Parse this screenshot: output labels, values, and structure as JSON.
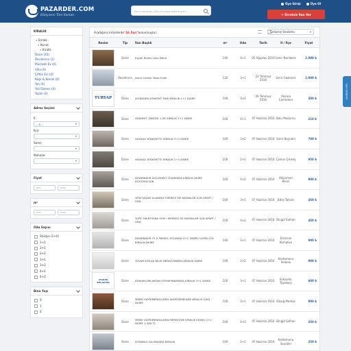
{
  "header": {
    "logo_title": "PAZARDER.COM",
    "logo_sub": "Dünyanın Tüm İlanları",
    "search_placeholder": "İlan numarası, ofis adı veya kelime girin...",
    "user_login": "Üye Girişi",
    "user_register": "Üye Ol",
    "post_button": "+ Ücretsiz İlan Ver"
  },
  "feedback_tab": "Geri Bildirim",
  "sidebar": {
    "category_title": "KİRALIK",
    "tree": [
      "» Emlak",
      "» Konut",
      "» Kiralık"
    ],
    "categories": [
      "Daire (45)",
      "Residence (1)",
      "Müstakil Ev (0)",
      "Villa (0)",
      "Çiftlik Evi (0)",
      "Köşk & Konak (0)",
      "Yalı (0)",
      "Yalı Dairesi (0)",
      "Yazlık (0)"
    ],
    "address_title": "Adres Seçimi",
    "il_label": "İl:",
    "il_value": "-- İl --",
    "ilce_label": "İlçe:",
    "semt_label": "Semt:",
    "mahalle_label": "Mahalle:",
    "price_title": "Fiyat",
    "price_min": "min",
    "price_max": "max",
    "area_title": "m²",
    "area_min": "min",
    "area_max": "max",
    "rooms_title": "Oda Sayısı",
    "rooms": [
      "Stüdyo (1+0)",
      "1+1",
      "2+1",
      "2+2",
      "3+1",
      "3+2",
      "4+1",
      "4+2"
    ],
    "age_title": "Bina Yaşı",
    "ages": [
      "0",
      "1",
      "2"
    ]
  },
  "results": {
    "prefix": "Aradığınız kriterlerde ",
    "count": "\"46 İlan\"",
    "suffix": " bulunmuştur.",
    "sort_label": "Gelişmiş Sıralama",
    "columns": [
      "Resim",
      "Tip",
      "İlan Başlık",
      "m²",
      "Oda",
      "Tarih",
      "İl / İlçe",
      "Fiyat"
    ],
    "rows": [
      {
        "thumb": "th1",
        "type": "Daire",
        "title": "Eşyalı Kiralık Lüks Daire",
        "m2": "140",
        "oda": "4+1",
        "date": "05 Ağustos 2016",
        "loc": "İzmir Narlıdere",
        "price": "2.000 ₺"
      },
      {
        "thumb": "th2",
        "type": "Residence",
        "title": "Zorlu Center Tetse Evler",
        "m2": "120",
        "oda": "3+1",
        "date": "23 Temmuz 2016",
        "loc": "İzmir Gaziemir",
        "price": "2.000 ₺"
      },
      {
        "thumb": "th3",
        "thumb_text": "TURYAP",
        "type": "Daire",
        "title": "ACIBADEM ATAKENT YANI KİRALIK 1+1 DAİRE",
        "m2": "100",
        "oda": "3+2",
        "date": "09 Temmuz 2016",
        "loc": "Ankara Çamlıdere",
        "price": "300 ₺"
      },
      {
        "thumb": "th4",
        "type": "Daire",
        "title": "ATAKENT ,DİKEDE 1 DE KİRALIK 3+1 DAİRE",
        "m2": "100",
        "oda": "4+1",
        "date": "07 Haziran 2016",
        "loc": "Bolu Mudurnu",
        "price": "210 ₺"
      },
      {
        "thumb": "th5",
        "type": "Daire",
        "title": "HALKALI ATAKENTTE KİRALIK 3+1 DAİRE",
        "m2": "100",
        "oda": "3+2",
        "date": "07 Haziran 2016",
        "loc": "İzmir Bayraklı",
        "price": "700 ₺"
      },
      {
        "thumb": "th6",
        "type": "Daire",
        "title": "HALKALI ATAKENTTE KİRALIK 2+1 DAİRE",
        "m2": "100",
        "oda": "2+2",
        "date": "07 Haziran 2016",
        "loc": "Çankırı Çerkeş",
        "price": "950 ₺"
      },
      {
        "thumb": "th7",
        "type": "Daire",
        "title": "DİYARBAKIR DİCLEKENT CİVARINDA KİRALIK DAİRE 05332841306",
        "m2": "100",
        "oda": "4+2",
        "date": "07 Haziran 2016",
        "loc": "Adıyaman Besni",
        "price": "900 ₺"
      },
      {
        "thumb": "th8",
        "type": "Daire",
        "title": "YENİ YAŞAM ALANINIZ MERKEZ DE BAYANLAR İÇİN APART / ODA",
        "m2": "100",
        "oda": "3+1",
        "date": "07 Haziran 2016",
        "loc": "Bitlis Tatvan",
        "price": "450 ₺"
      },
      {
        "thumb": "th9",
        "type": "Daire",
        "title": "YURT SIKINTISINA SON ! MERKEZ DE BAYANLAR İÇİN APART / ODA",
        "m2": "100",
        "oda": "4+2",
        "date": "07 Haziran 2016",
        "loc": "Bingöl Solhan",
        "price": "450 ₺"
      },
      {
        "thumb": "th10",
        "type": "Daire",
        "title": "DİYARBAKIR 75 2 PARSEL YOLUNDA 4+1 300M2 ULTRA LÜX KİRALIK DAİRE",
        "m2": "100",
        "oda": "3+1",
        "date": "07 Haziran 2016",
        "loc": "Erzincan Kemaliye",
        "price": "900 ₺"
      },
      {
        "thumb": "th11",
        "type": "Daire",
        "title": "YUVAM EMLAK BİLİR MERKEZİNDEN KİRALIK DAİRE",
        "m2": "100",
        "oda": "2+2",
        "date": "07 Haziran 2016",
        "loc": "Kastamonu İnebolu",
        "price": "900 ₺"
      },
      {
        "thumb": "th12",
        "thumb_text": "ATAKAN EMLAKTAN",
        "type": "Daire",
        "title": "ATAKAN EMLAKTAN SITMAPINARINDA KİRALIK 3+1 DAİRE",
        "m2": "100",
        "oda": "3+1",
        "date": "07 Haziran 2016",
        "loc": "Eskişehir Tepebaşı",
        "price": "600 ₺"
      },
      {
        "thumb": "th13",
        "type": "Daire",
        "title": "MİRAY GAYRİMENKULDEN AKDEĞİRMENDE KİRALIK LÜKS DAİRE",
        "m2": "100",
        "oda": "3+1",
        "date": "07 Haziran 2016",
        "loc": "Elazığ Merkez",
        "price": "900 ₺"
      },
      {
        "thumb": "th14",
        "type": "Daire",
        "title": "MİRAY GAYRİMENKULDEN MERKEZDE KİRALIK EŞYALI 2+1 DAİRE 1.400 TL",
        "m2": "100",
        "oda": "4+3",
        "date": "07 Haziran 2016",
        "loc": "Bingöl Solhan",
        "price": "250 ₺"
      },
      {
        "thumb": "th15",
        "type": "Daire",
        "title": "İSTANBUL DA BEKARA KİRALIK",
        "m2": "100",
        "oda": "2+1",
        "date": "07 Haziran 2016",
        "loc": "Kastamonu Seydiler",
        "price": "250 ₺"
      }
    ]
  }
}
